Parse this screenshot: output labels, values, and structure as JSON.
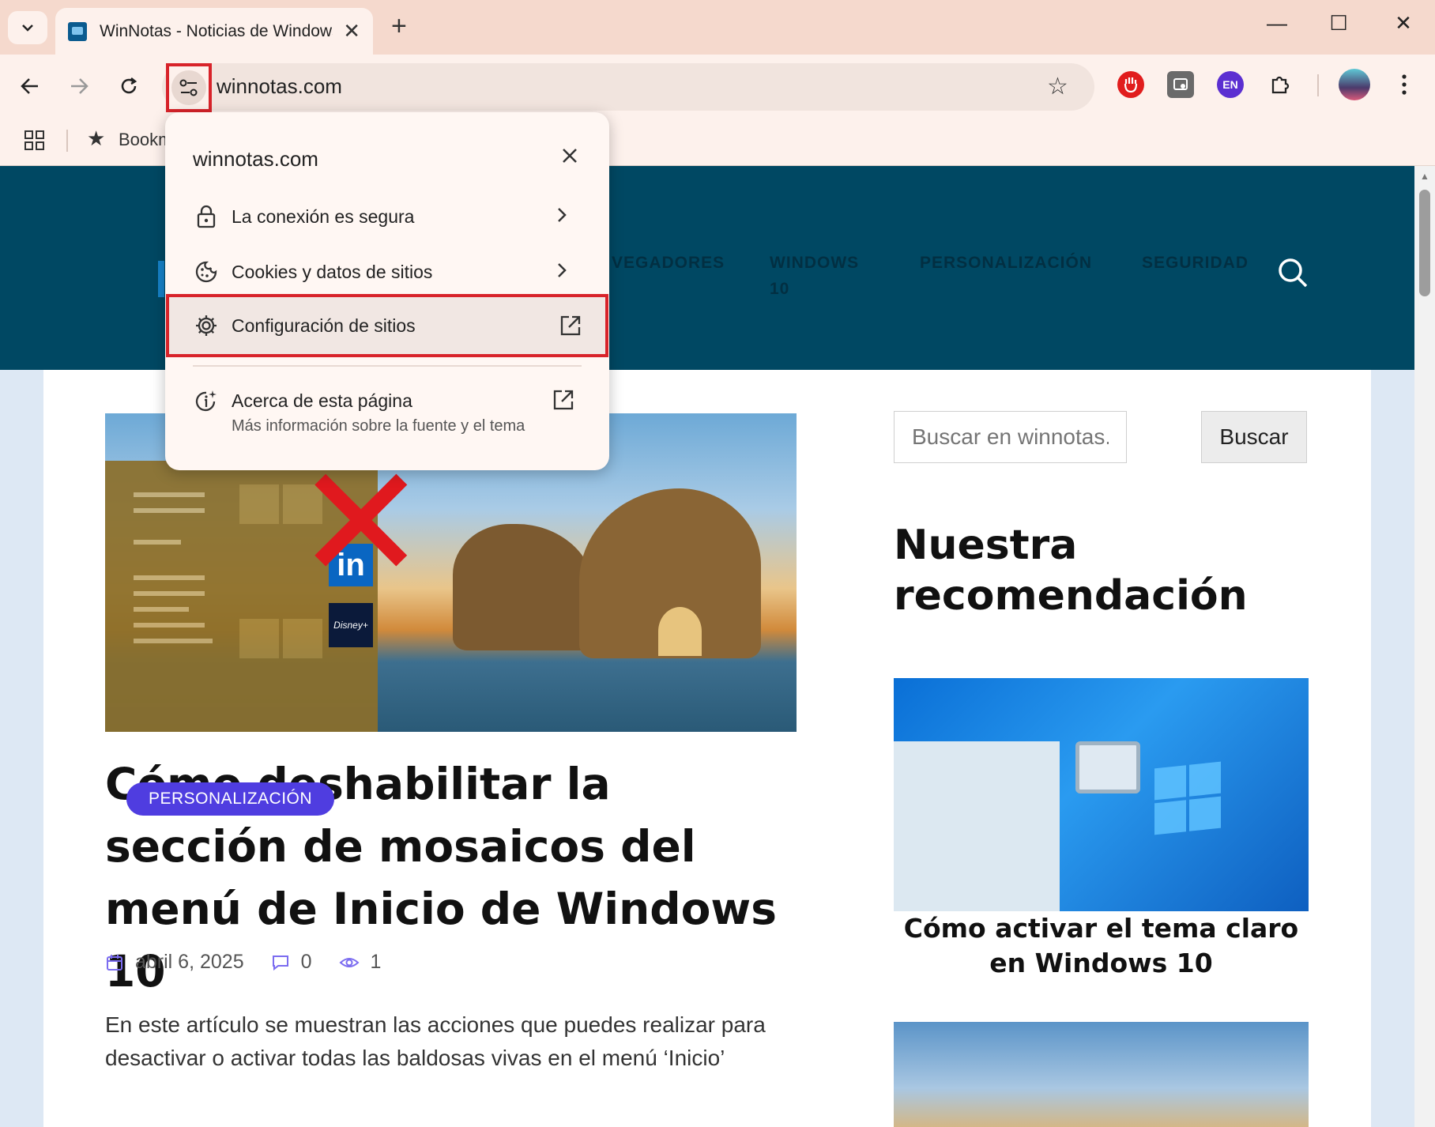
{
  "browser": {
    "tab_title": "WinNotas - Noticias de Windows",
    "url": "winnotas.com",
    "bookmarks_label": "Bookm",
    "extension_en_label": "EN"
  },
  "site_info_popup": {
    "host": "winnotas.com",
    "items": [
      {
        "label": "La conexión es segura"
      },
      {
        "label": "Cookies y datos de sitios"
      },
      {
        "label": "Configuración de sitios"
      }
    ],
    "about": {
      "title": "Acerca de esta página",
      "subtitle": "Más información sobre la fuente y el tema"
    }
  },
  "site": {
    "menu": [
      "VEGADORES",
      "WINDOWS 10",
      "PERSONALIZACIÓN",
      "SEGURIDAD"
    ],
    "article": {
      "category": "PERSONALIZACIÓN",
      "title": "Cómo deshabilitar la sección de mosaicos del menú de Inicio de Windows 10",
      "date": "abril 6, 2025",
      "comments": "0",
      "views": "1",
      "excerpt": "En este artículo se muestran las acciones que puedes realizar para desactivar o activar todas las baldosas vivas en el menú ‘Inicio’"
    },
    "sidebar": {
      "search_placeholder": "Buscar en winnotas.com",
      "search_button": "Buscar",
      "heading": "Nuestra recomendación",
      "rec_title": "Cómo activar el tema claro en Windows 10"
    }
  },
  "colors": {
    "header_bg": "#004863",
    "badge_bg": "#4f3de0",
    "highlight": "#d8232a",
    "chrome_tabstrip": "#f5d9cd"
  }
}
